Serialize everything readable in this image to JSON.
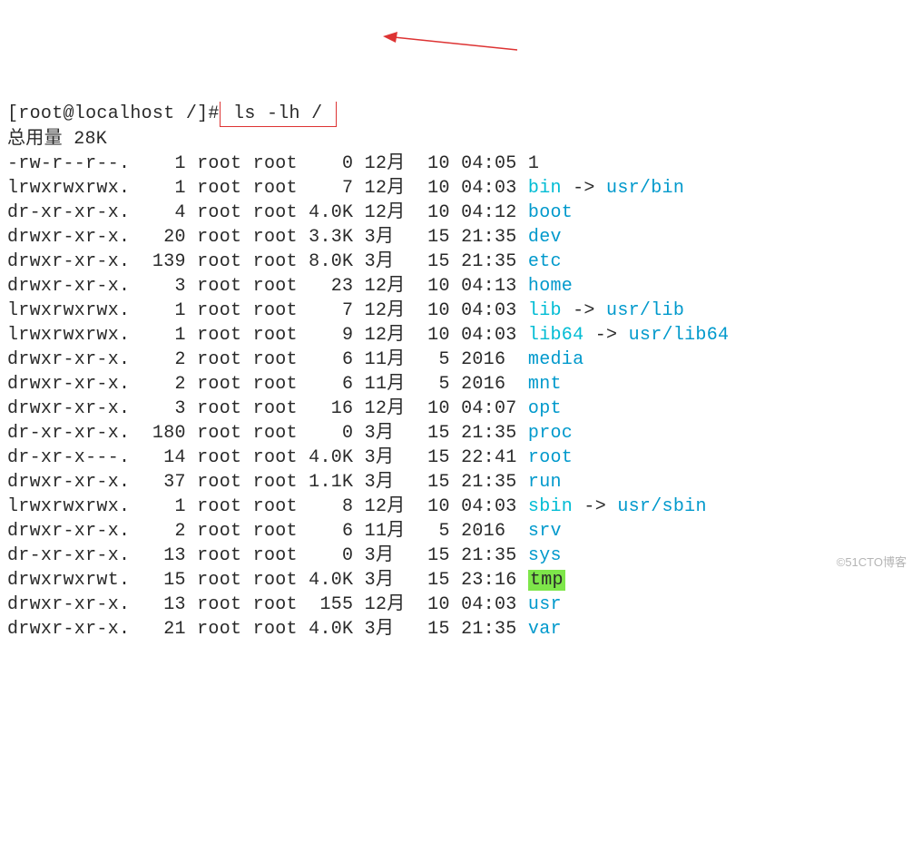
{
  "prompt": {
    "user": "root",
    "host": "localhost",
    "cwd": "/",
    "cmd": "ls -lh /"
  },
  "total": {
    "label": "总用量",
    "value": "28K"
  },
  "rows": [
    {
      "perm": "-rw-r--r--.",
      "lnk": "1",
      "u": "root",
      "g": "root",
      "sz": "0",
      "mon": "12月",
      "day": "10",
      "time": "04:05",
      "name": "1",
      "style": "plain",
      "target": ""
    },
    {
      "perm": "lrwxrwxrwx.",
      "lnk": "1",
      "u": "root",
      "g": "root",
      "sz": "7",
      "mon": "12月",
      "day": "10",
      "time": "04:03",
      "name": "bin",
      "style": "link",
      "target": "usr/bin"
    },
    {
      "perm": "dr-xr-xr-x.",
      "lnk": "4",
      "u": "root",
      "g": "root",
      "sz": "4.0K",
      "mon": "12月",
      "day": "10",
      "time": "04:12",
      "name": "boot",
      "style": "dir",
      "target": ""
    },
    {
      "perm": "drwxr-xr-x.",
      "lnk": "20",
      "u": "root",
      "g": "root",
      "sz": "3.3K",
      "mon": "3月",
      "day": "15",
      "time": "21:35",
      "name": "dev",
      "style": "dir",
      "target": ""
    },
    {
      "perm": "drwxr-xr-x.",
      "lnk": "139",
      "u": "root",
      "g": "root",
      "sz": "8.0K",
      "mon": "3月",
      "day": "15",
      "time": "21:35",
      "name": "etc",
      "style": "dir",
      "target": ""
    },
    {
      "perm": "drwxr-xr-x.",
      "lnk": "3",
      "u": "root",
      "g": "root",
      "sz": "23",
      "mon": "12月",
      "day": "10",
      "time": "04:13",
      "name": "home",
      "style": "dir",
      "target": ""
    },
    {
      "perm": "lrwxrwxrwx.",
      "lnk": "1",
      "u": "root",
      "g": "root",
      "sz": "7",
      "mon": "12月",
      "day": "10",
      "time": "04:03",
      "name": "lib",
      "style": "link",
      "target": "usr/lib"
    },
    {
      "perm": "lrwxrwxrwx.",
      "lnk": "1",
      "u": "root",
      "g": "root",
      "sz": "9",
      "mon": "12月",
      "day": "10",
      "time": "04:03",
      "name": "lib64",
      "style": "link",
      "target": "usr/lib64"
    },
    {
      "perm": "drwxr-xr-x.",
      "lnk": "2",
      "u": "root",
      "g": "root",
      "sz": "6",
      "mon": "11月",
      "day": "5",
      "time": "2016",
      "name": "media",
      "style": "dir",
      "target": ""
    },
    {
      "perm": "drwxr-xr-x.",
      "lnk": "2",
      "u": "root",
      "g": "root",
      "sz": "6",
      "mon": "11月",
      "day": "5",
      "time": "2016",
      "name": "mnt",
      "style": "dir",
      "target": ""
    },
    {
      "perm": "drwxr-xr-x.",
      "lnk": "3",
      "u": "root",
      "g": "root",
      "sz": "16",
      "mon": "12月",
      "day": "10",
      "time": "04:07",
      "name": "opt",
      "style": "dir",
      "target": ""
    },
    {
      "perm": "dr-xr-xr-x.",
      "lnk": "180",
      "u": "root",
      "g": "root",
      "sz": "0",
      "mon": "3月",
      "day": "15",
      "time": "21:35",
      "name": "proc",
      "style": "dir",
      "target": ""
    },
    {
      "perm": "dr-xr-x---.",
      "lnk": "14",
      "u": "root",
      "g": "root",
      "sz": "4.0K",
      "mon": "3月",
      "day": "15",
      "time": "22:41",
      "name": "root",
      "style": "dir",
      "target": ""
    },
    {
      "perm": "drwxr-xr-x.",
      "lnk": "37",
      "u": "root",
      "g": "root",
      "sz": "1.1K",
      "mon": "3月",
      "day": "15",
      "time": "21:35",
      "name": "run",
      "style": "dir",
      "target": ""
    },
    {
      "perm": "lrwxrwxrwx.",
      "lnk": "1",
      "u": "root",
      "g": "root",
      "sz": "8",
      "mon": "12月",
      "day": "10",
      "time": "04:03",
      "name": "sbin",
      "style": "link",
      "target": "usr/sbin"
    },
    {
      "perm": "drwxr-xr-x.",
      "lnk": "2",
      "u": "root",
      "g": "root",
      "sz": "6",
      "mon": "11月",
      "day": "5",
      "time": "2016",
      "name": "srv",
      "style": "dir",
      "target": ""
    },
    {
      "perm": "dr-xr-xr-x.",
      "lnk": "13",
      "u": "root",
      "g": "root",
      "sz": "0",
      "mon": "3月",
      "day": "15",
      "time": "21:35",
      "name": "sys",
      "style": "dir",
      "target": ""
    },
    {
      "perm": "drwxrwxrwt.",
      "lnk": "15",
      "u": "root",
      "g": "root",
      "sz": "4.0K",
      "mon": "3月",
      "day": "15",
      "time": "23:16",
      "name": "tmp",
      "style": "sticky",
      "target": ""
    },
    {
      "perm": "drwxr-xr-x.",
      "lnk": "13",
      "u": "root",
      "g": "root",
      "sz": "155",
      "mon": "12月",
      "day": "10",
      "time": "04:03",
      "name": "usr",
      "style": "dir",
      "target": ""
    },
    {
      "perm": "drwxr-xr-x.",
      "lnk": "21",
      "u": "root",
      "g": "root",
      "sz": "4.0K",
      "mon": "3月",
      "day": "15",
      "time": "21:35",
      "name": "var",
      "style": "dir",
      "target": ""
    }
  ],
  "watermark": "©51CTO博客"
}
